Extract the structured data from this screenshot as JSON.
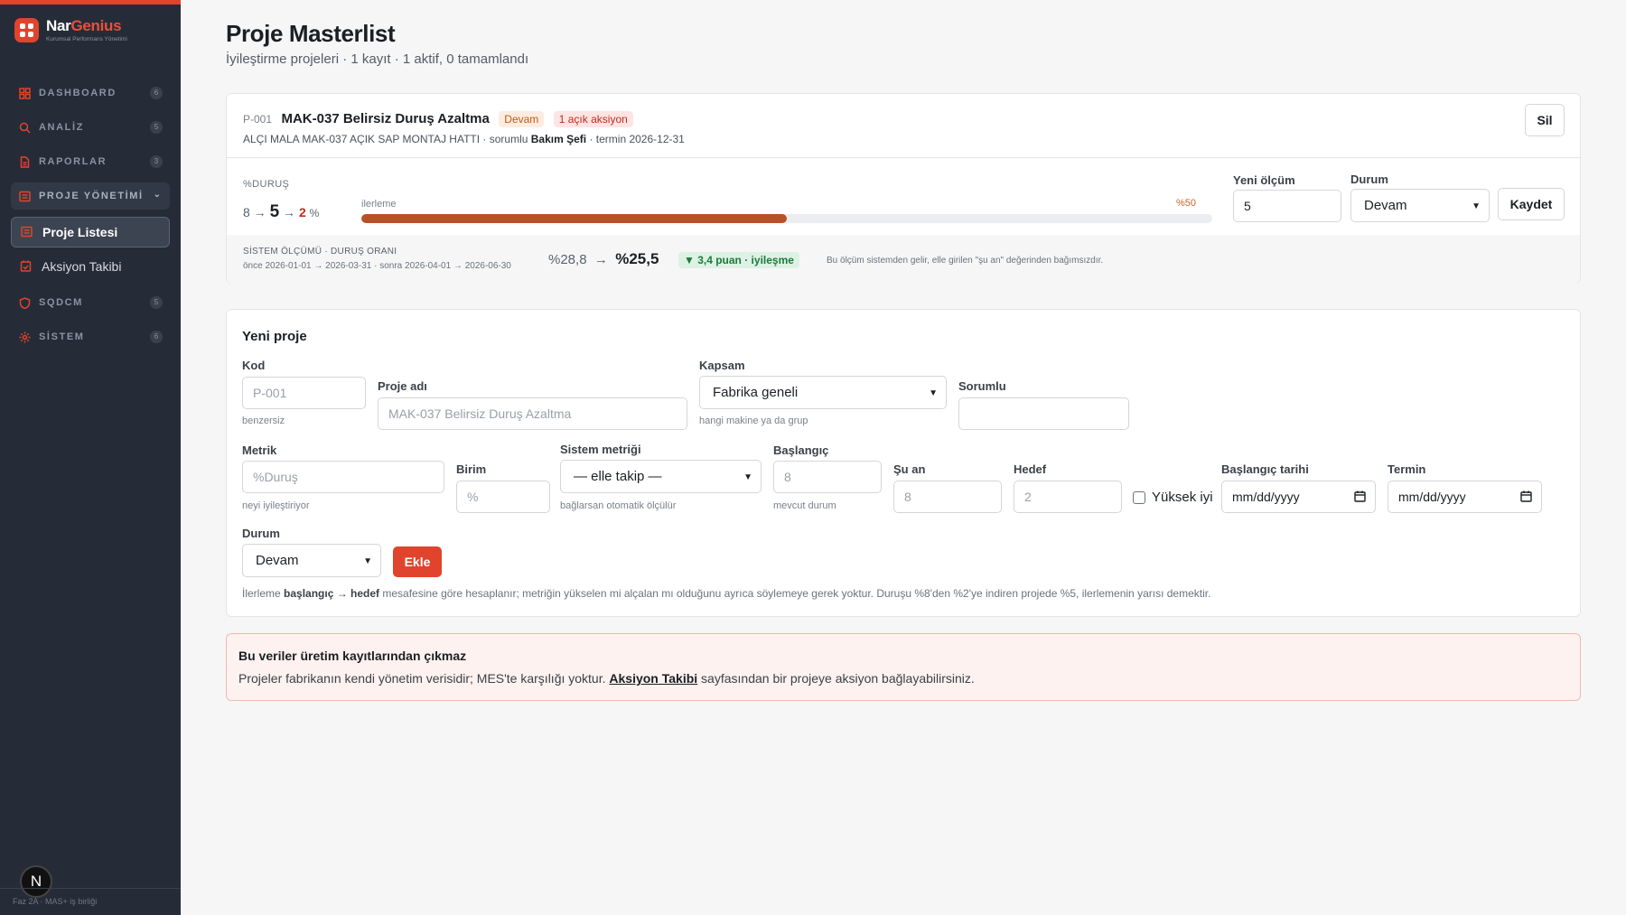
{
  "brand": {
    "name_part1": "Nar",
    "name_part2": "Genius",
    "subtitle": "Kurumsal Performans Yönetimi"
  },
  "sidebar": {
    "items": [
      {
        "label": "DASHBOARD",
        "count": "6",
        "icon": "grid-icon"
      },
      {
        "label": "ANALİZ",
        "count": "5",
        "icon": "search-icon"
      },
      {
        "label": "RAPORLAR",
        "count": "3",
        "icon": "document-icon"
      },
      {
        "label": "PROJE YÖNETİMİ",
        "icon": "list-icon",
        "expanded": true
      },
      {
        "label": "SQDCM",
        "count": "5",
        "icon": "shield-icon"
      },
      {
        "label": "SİSTEM",
        "count": "6",
        "icon": "gear-icon"
      }
    ],
    "sub_items": [
      {
        "label": "Proje Listesi",
        "active": true
      },
      {
        "label": "Aksiyon Takibi",
        "active": false
      }
    ],
    "badge": "N",
    "footer": "Faz 2A · MAS+ iş birliği"
  },
  "page": {
    "title": "Proje Masterlist",
    "subtitle": "İyileştirme projeleri · 1 kayıt · 1 aktif, 0 tamamlandı"
  },
  "project": {
    "code": "P-001",
    "name": "MAK-037 Belirsiz Duruş Azaltma",
    "status_tag": "Devam",
    "actions_tag": "1 açık aksiyon",
    "meta_prefix": "ALÇI MALA MAK-037 AÇIK SAP MONTAJ HATTI · sorumlu ",
    "owner": "Bakım Şefi",
    "meta_suffix": " · termin 2026-12-31",
    "delete_label": "Sil",
    "metric_label": "%DURUŞ",
    "baseline": "8",
    "current": "5",
    "target": "2",
    "unit": "%",
    "progress_label": "ilerleme",
    "progress_text": "%50",
    "progress_value": 0.5,
    "new_measure_label": "Yeni ölçüm",
    "new_measure_value": "5",
    "status_label": "Durum",
    "status_value": "Devam",
    "save_label": "Kaydet",
    "system": {
      "label": "SİSTEM ÖLÇÜMÜ · DURUŞ ORANI",
      "range": "önce 2026-01-01 → 2026-03-31 · sonra 2026-04-01 → 2026-06-30",
      "before": "%28,8",
      "arrow": "→",
      "after": "%25,5",
      "badge": "▼ 3,4 puan · iyileşme",
      "note": "Bu ölçüm sistemden gelir, elle girilen \"şu an\" değerinden bağımsızdır."
    }
  },
  "form": {
    "title": "Yeni proje",
    "code": {
      "label": "Kod",
      "placeholder": "P-001",
      "hint": "benzersiz"
    },
    "name": {
      "label": "Proje adı",
      "placeholder": "MAK-037 Belirsiz Duruş Azaltma"
    },
    "scope": {
      "label": "Kapsam",
      "value": "Fabrika geneli",
      "hint": "hangi makine ya da grup"
    },
    "owner": {
      "label": "Sorumlu",
      "value": ""
    },
    "metric": {
      "label": "Metrik",
      "placeholder": "%Duruş",
      "hint": "neyi iyileştiriyor"
    },
    "unit": {
      "label": "Birim",
      "placeholder": "%"
    },
    "system_metric": {
      "label": "Sistem metriği",
      "value": "— elle takip —",
      "hint": "bağlarsan otomatik ölçülür"
    },
    "start": {
      "label": "Başlangıç",
      "placeholder": "8",
      "hint": "mevcut durum"
    },
    "now": {
      "label": "Şu an",
      "placeholder": "8"
    },
    "target": {
      "label": "Hedef",
      "placeholder": "2"
    },
    "higher_better": {
      "label": "Yüksek iyi",
      "checked": false
    },
    "start_date": {
      "label": "Başlangıç tarihi",
      "placeholder": "mm/dd/yyyy"
    },
    "due_date": {
      "label": "Termin",
      "placeholder": "mm/dd/yyyy"
    },
    "status": {
      "label": "Durum",
      "value": "Devam"
    },
    "add_label": "Ekle",
    "footnote_1": "İlerleme ",
    "footnote_bold": "başlangıç → hedef",
    "footnote_2": " mesafesine göre hesaplanır; metriğin yükselen mi alçalan mı olduğunu ayrıca söylemeye gerek yoktur. Duruşu %8'den %2'ye indiren projede %5, ilerlemenin yarısı demektir."
  },
  "notice": {
    "title": "Bu veriler üretim kayıtlarından çıkmaz",
    "text_1": "Projeler fabrikanın kendi yönetim verisidir; MES'te karşılığı yoktur. ",
    "link": "Aksiyon Takibi",
    "text_2": " sayfasından bir projeye aksiyon bağlayabilirsiniz."
  },
  "colors": {
    "accent": "#e0442c",
    "sidebar_bg": "#262c37",
    "progress": "#b85129"
  }
}
